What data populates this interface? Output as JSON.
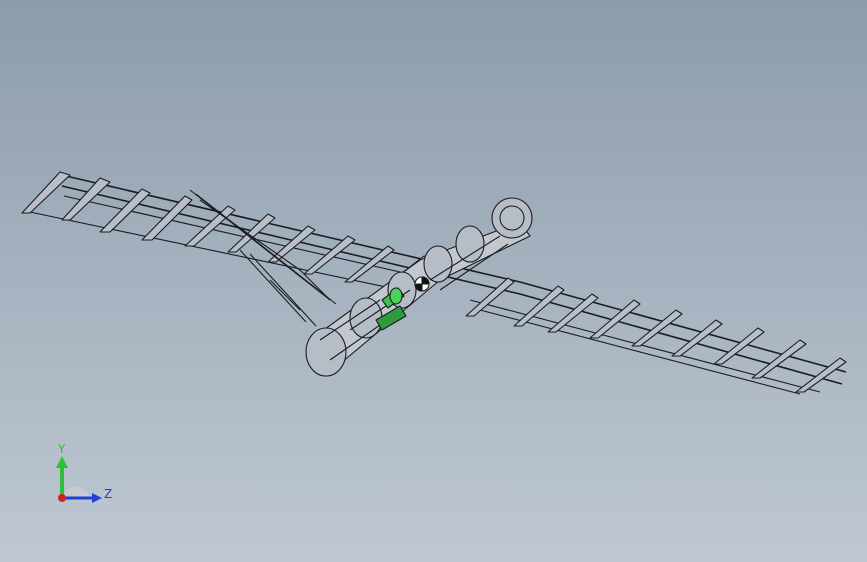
{
  "viewport": {
    "background_top": "#8d9cab",
    "background_bottom": "#bfc8d2",
    "model_line_color": "#1a1d22",
    "model_fill_color": "#b9bfc8",
    "highlight_color": "#39c24a"
  },
  "triad": {
    "y_label": "Y",
    "z_label": "Z",
    "y_color": "#2fbf3a",
    "z_color": "#1f3fd6",
    "x_color": "#d61f1f"
  }
}
